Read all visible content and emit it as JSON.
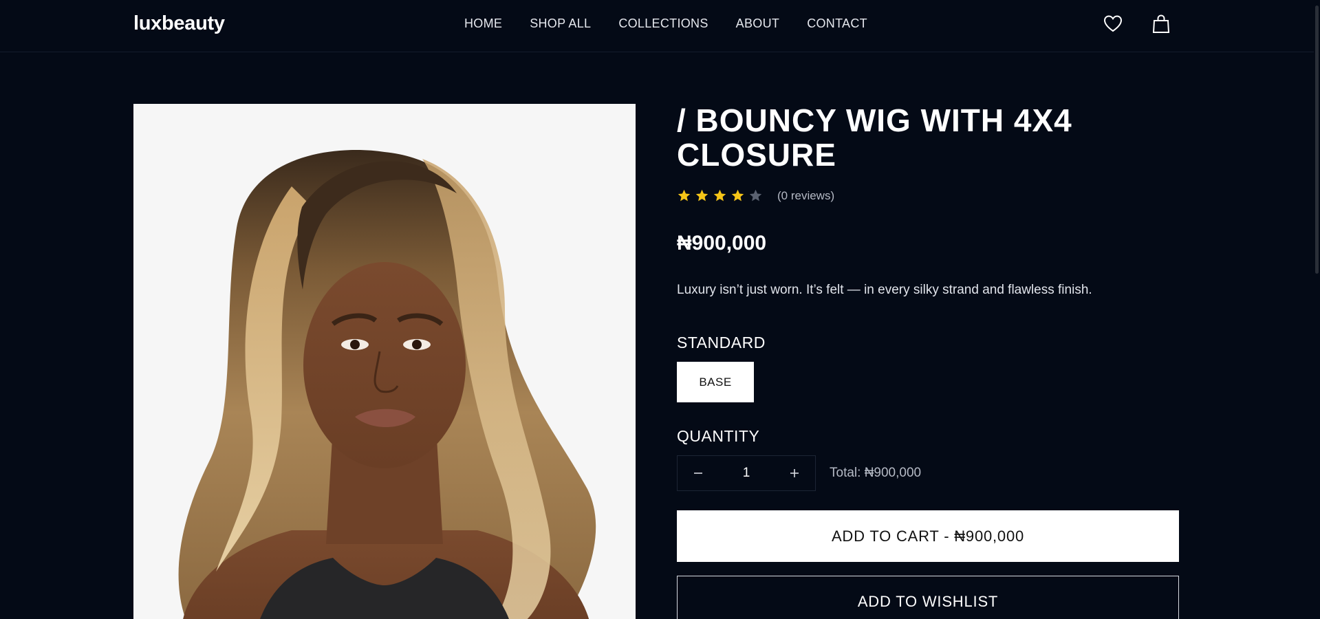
{
  "brand": {
    "logo_text": "luxbeauty"
  },
  "nav": {
    "items": [
      {
        "label": "HOME"
      },
      {
        "label": "SHOP ALL"
      },
      {
        "label": "COLLECTIONS"
      },
      {
        "label": "ABOUT"
      },
      {
        "label": "CONTACT"
      }
    ]
  },
  "header_icons": {
    "wishlist": "heart-icon",
    "cart": "shopping-bag-icon"
  },
  "product": {
    "title": "/ BOUNCY WIG WITH 4X4 CLOSURE",
    "rating": {
      "value": 4,
      "max": 5,
      "reviews_text": "(0 reviews)"
    },
    "price": "₦900,000",
    "description": "Luxury isn’t just worn. It’s felt — in every silky strand and flawless finish.",
    "variant_group_label": "STANDARD",
    "variants": [
      {
        "label": "BASE",
        "selected": true
      }
    ],
    "quantity_label": "QUANTITY",
    "quantity": "1",
    "total_text": "Total: ₦900,000",
    "add_to_cart_label": "ADD TO CART - ₦900,000",
    "add_to_wishlist_label": "ADD TO WISHLIST"
  },
  "colors": {
    "background": "#040a16",
    "star_filled": "#f5c518",
    "star_empty": "#5a6170",
    "primary_button": "#ffffff"
  }
}
